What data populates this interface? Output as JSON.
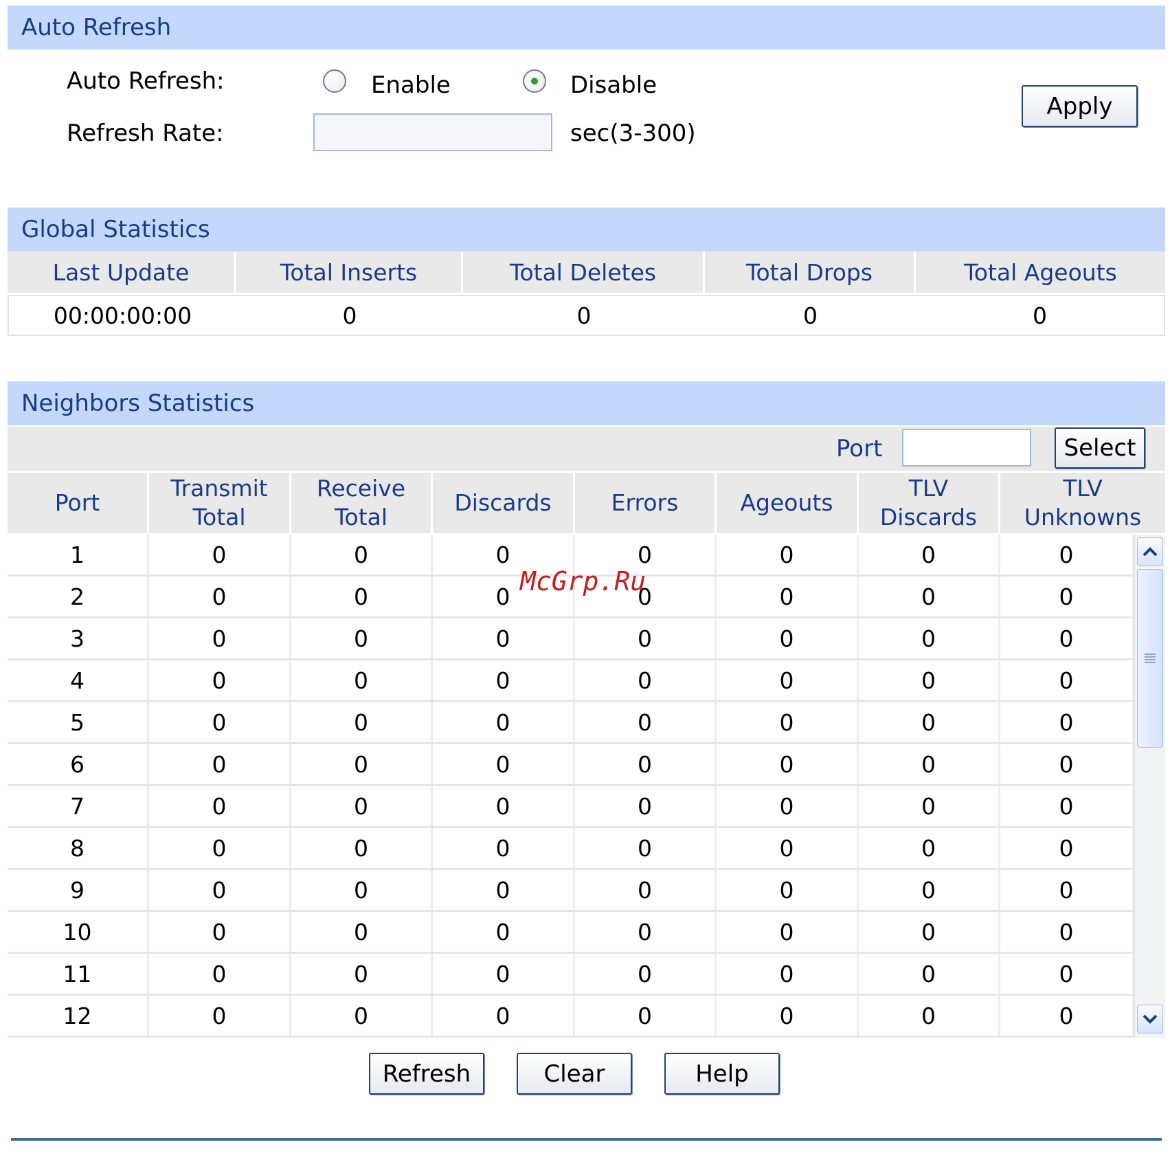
{
  "auto_refresh": {
    "section_title": "Auto Refresh",
    "auto_refresh_label": "Auto Refresh:",
    "enable_label": "Enable",
    "disable_label": "Disable",
    "selected": "Disable",
    "refresh_rate_label": "Refresh Rate:",
    "refresh_rate_value": "",
    "unit_hint": "sec(3-300)",
    "apply_label": "Apply"
  },
  "global_statistics": {
    "section_title": "Global Statistics",
    "columns": [
      "Last Update",
      "Total Inserts",
      "Total Deletes",
      "Total Drops",
      "Total Ageouts"
    ],
    "row": [
      "00:00:00:00",
      "0",
      "0",
      "0",
      "0"
    ]
  },
  "neighbors_statistics": {
    "section_title": "Neighbors Statistics",
    "port_filter_label": "Port",
    "port_filter_value": "",
    "select_label": "Select",
    "columns": [
      "Port",
      "Transmit\nTotal",
      "Receive\nTotal",
      "Discards",
      "Errors",
      "Ageouts",
      "TLV\nDiscards",
      "TLV\nUnknowns"
    ],
    "rows": [
      [
        "1",
        "0",
        "0",
        "0",
        "0",
        "0",
        "0",
        "0"
      ],
      [
        "2",
        "0",
        "0",
        "0",
        "0",
        "0",
        "0",
        "0"
      ],
      [
        "3",
        "0",
        "0",
        "0",
        "0",
        "0",
        "0",
        "0"
      ],
      [
        "4",
        "0",
        "0",
        "0",
        "0",
        "0",
        "0",
        "0"
      ],
      [
        "5",
        "0",
        "0",
        "0",
        "0",
        "0",
        "0",
        "0"
      ],
      [
        "6",
        "0",
        "0",
        "0",
        "0",
        "0",
        "0",
        "0"
      ],
      [
        "7",
        "0",
        "0",
        "0",
        "0",
        "0",
        "0",
        "0"
      ],
      [
        "8",
        "0",
        "0",
        "0",
        "0",
        "0",
        "0",
        "0"
      ],
      [
        "9",
        "0",
        "0",
        "0",
        "0",
        "0",
        "0",
        "0"
      ],
      [
        "10",
        "0",
        "0",
        "0",
        "0",
        "0",
        "0",
        "0"
      ],
      [
        "11",
        "0",
        "0",
        "0",
        "0",
        "0",
        "0",
        "0"
      ],
      [
        "12",
        "0",
        "0",
        "0",
        "0",
        "0",
        "0",
        "0"
      ]
    ]
  },
  "actions": {
    "refresh_label": "Refresh",
    "clear_label": "Clear",
    "help_label": "Help"
  },
  "watermark": "McGrp.Ru"
}
